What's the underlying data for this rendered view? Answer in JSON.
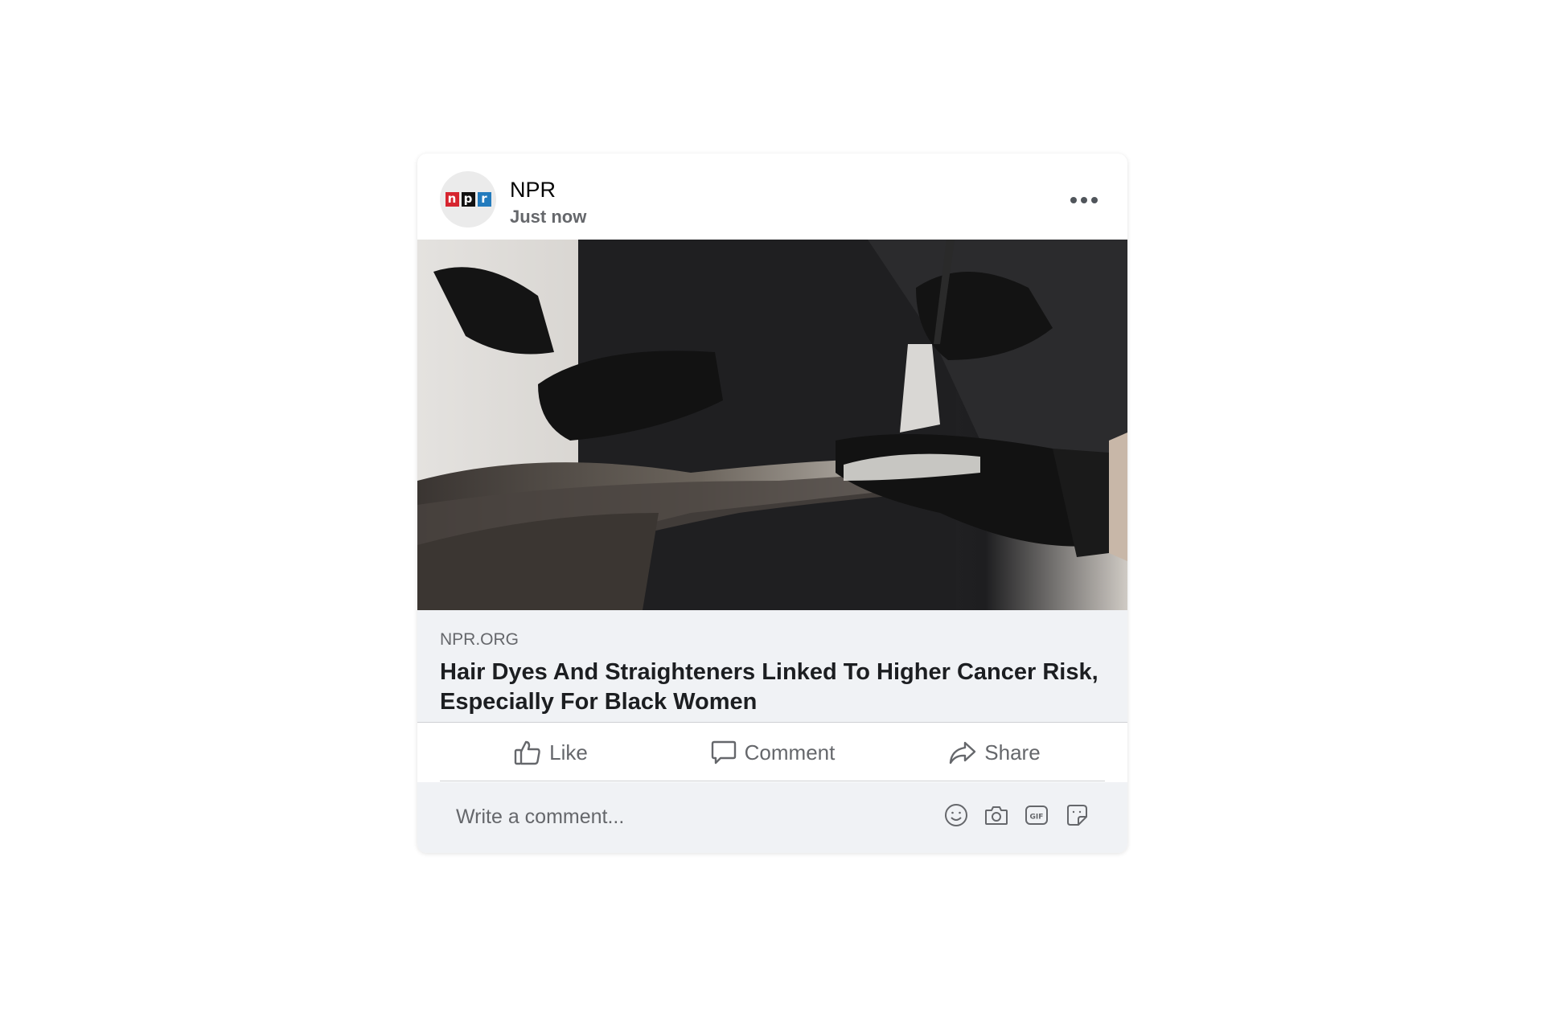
{
  "post": {
    "author": "NPR",
    "time": "Just now",
    "avatar_logo_letters": [
      "n",
      "p",
      "r"
    ]
  },
  "image": {
    "alt": "Hair dye being applied to long dark hair with a brush by a stylist in black gloves"
  },
  "link": {
    "domain": "NPR.ORG",
    "title": "Hair Dyes And Straighteners Linked To Higher Cancer Risk, Especially For Black Women"
  },
  "actions": {
    "like": "Like",
    "comment": "Comment",
    "share": "Share"
  },
  "comment_box": {
    "placeholder": "Write a comment...",
    "icons": [
      "emoji-icon",
      "camera-icon",
      "gif-icon",
      "sticker-icon"
    ],
    "gif_label": "GIF"
  },
  "colors": {
    "secondary_text": "#65676b",
    "preview_background": "#f0f2f5",
    "npr_red": "#d6252f",
    "npr_black": "#111111",
    "npr_blue": "#237bbd"
  }
}
